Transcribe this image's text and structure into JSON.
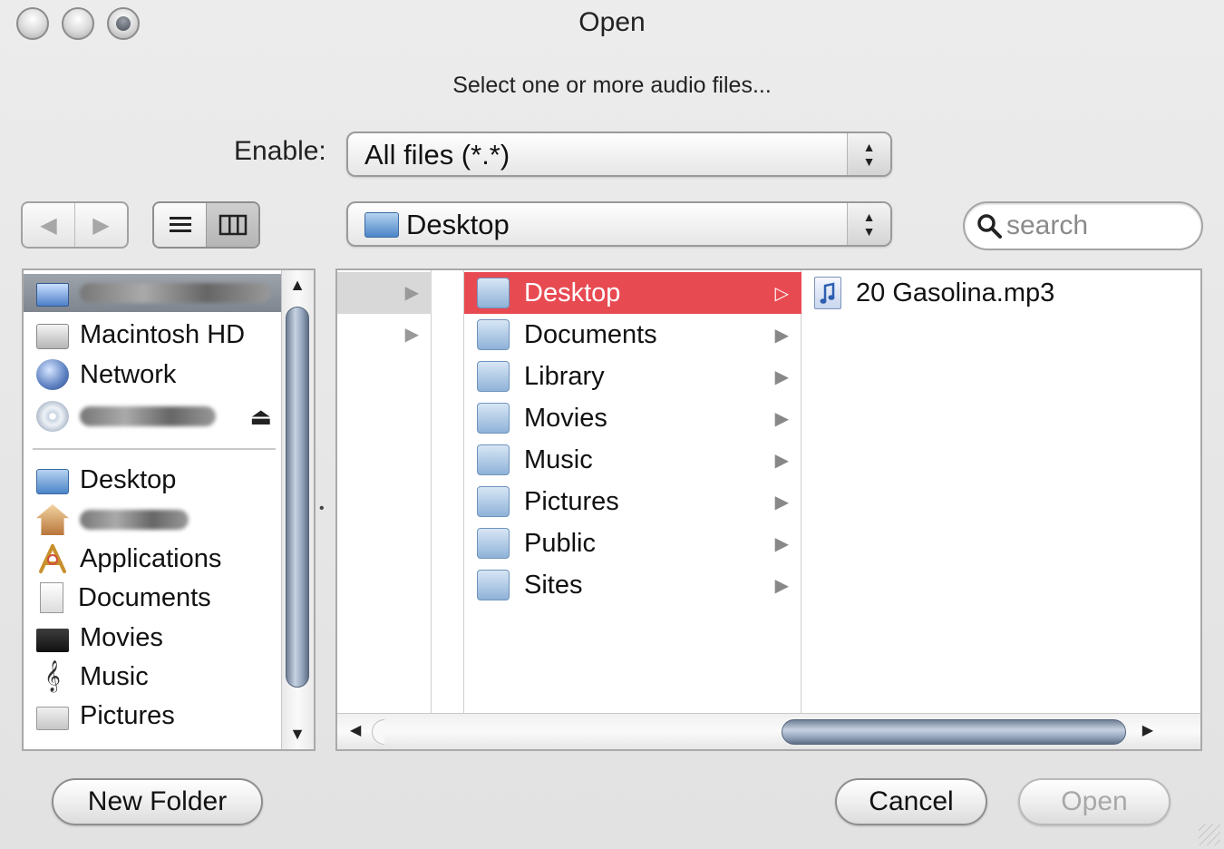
{
  "window": {
    "title": "Open",
    "prompt": "Select one or more audio files..."
  },
  "filter": {
    "label": "Enable:",
    "value": "All files (*.*)"
  },
  "path": {
    "value": "Desktop"
  },
  "search": {
    "placeholder": "search"
  },
  "navigation": {
    "back_icon": "back-arrow-icon",
    "forward_icon": "forward-arrow-icon"
  },
  "view_modes": {
    "list_icon": "list-view-icon",
    "column_icon": "column-view-icon",
    "active": "column"
  },
  "sidebar": {
    "devices": [
      {
        "label": "",
        "icon": "computer-icon",
        "redacted": true,
        "selected": true
      },
      {
        "label": "Macintosh HD",
        "icon": "hard-drive-icon"
      },
      {
        "label": "Network",
        "icon": "network-globe-icon"
      },
      {
        "label": "",
        "icon": "disc-icon",
        "redacted": true,
        "ejectable": true
      }
    ],
    "places": [
      {
        "label": "Desktop",
        "icon": "desktop-icon"
      },
      {
        "label": "",
        "icon": "home-icon",
        "redacted": true
      },
      {
        "label": "Applications",
        "icon": "applications-icon"
      },
      {
        "label": "Documents",
        "icon": "document-icon"
      },
      {
        "label": "Movies",
        "icon": "movies-icon"
      },
      {
        "label": "Music",
        "icon": "music-icon"
      },
      {
        "label": "Pictures",
        "icon": "pictures-icon"
      }
    ]
  },
  "browser": {
    "column2": [
      {
        "label": "Desktop",
        "selected": true
      },
      {
        "label": "Documents"
      },
      {
        "label": "Library"
      },
      {
        "label": "Movies"
      },
      {
        "label": "Music"
      },
      {
        "label": "Pictures"
      },
      {
        "label": "Public"
      },
      {
        "label": "Sites"
      }
    ],
    "column3": [
      {
        "label": "20 Gasolina.mp3",
        "icon": "audio-file-icon"
      }
    ]
  },
  "buttons": {
    "new_folder": "New Folder",
    "cancel": "Cancel",
    "open": "Open"
  },
  "colors": {
    "selection": "#e84a52",
    "sidebar_selection": "#8a9098",
    "scroll_thumb": "#98a9bf"
  }
}
